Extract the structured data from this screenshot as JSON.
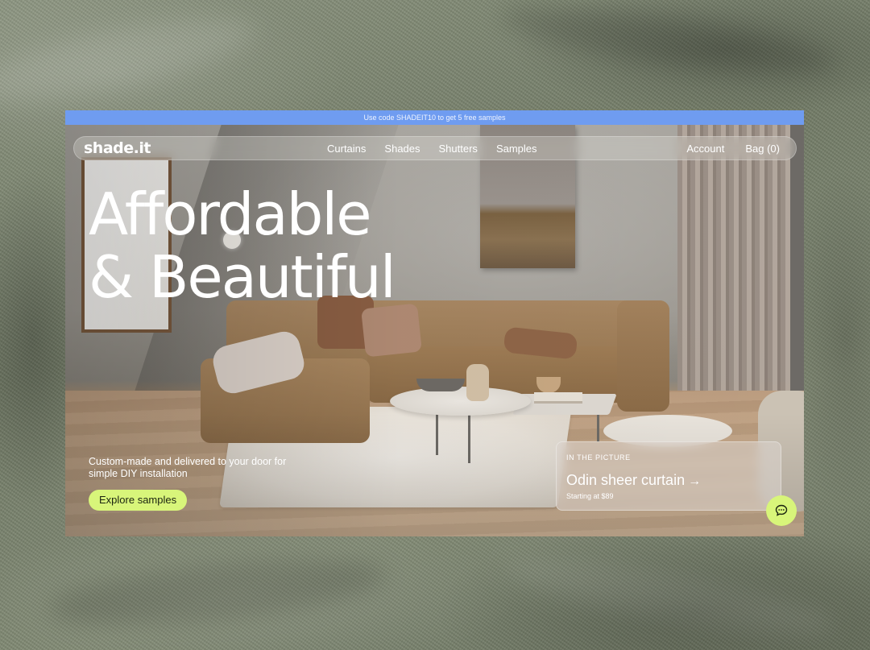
{
  "promo": {
    "text": "Use code SHADEIT10 to get 5 free samples"
  },
  "nav": {
    "logo": "shade.it",
    "links": [
      "Curtains",
      "Shades",
      "Shutters",
      "Samples"
    ],
    "account": "Account",
    "bag": "Bag (0)"
  },
  "hero": {
    "headline_line1": "Affordable",
    "headline_line2": "& Beautiful",
    "subtitle": "Custom-made and delivered to your door for simple DIY installation",
    "cta": "Explore samples"
  },
  "picture_card": {
    "eyebrow": "IN THE PICTURE",
    "title": "Odin sheer curtain",
    "arrow": "→",
    "price": "Starting at $89"
  },
  "chat": {
    "icon": "chat-bubble-icon"
  },
  "colors": {
    "promo_bar": "#6f9cf0",
    "accent_lime": "#d8f57a",
    "background_linen": "#7c8570"
  }
}
